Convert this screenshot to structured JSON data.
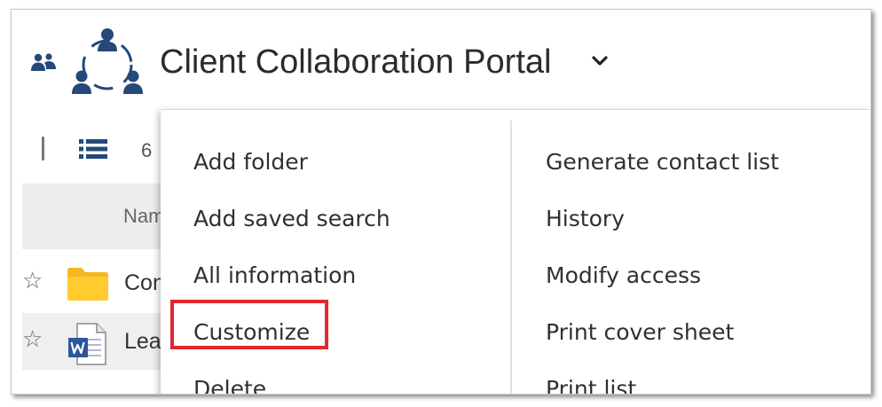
{
  "header": {
    "title": "Client Collaboration Portal",
    "icons": [
      "people-icon",
      "team-logo-icon",
      "chevron-down-icon"
    ]
  },
  "toolbar": {
    "count": "6",
    "icons": [
      "list-view-icon"
    ]
  },
  "table": {
    "columns": [
      "Nam"
    ],
    "rows": [
      {
        "name": "Con",
        "icon": "folder-icon"
      },
      {
        "name": "Lea",
        "icon": "word-document-icon"
      }
    ]
  },
  "menu": {
    "col1": [
      "Add folder",
      "Add saved search",
      "All information",
      "Customize",
      "Delete"
    ],
    "col2": [
      "Generate contact list",
      "History",
      "Modify access",
      "Print cover sheet",
      "Print list"
    ],
    "highlighted_item": "Customize"
  },
  "colors": {
    "brand_blue": "#24497a",
    "highlight_red": "#e0282e",
    "folder_yellow": "#ffcb2f",
    "word_blue": "#2b579a"
  }
}
